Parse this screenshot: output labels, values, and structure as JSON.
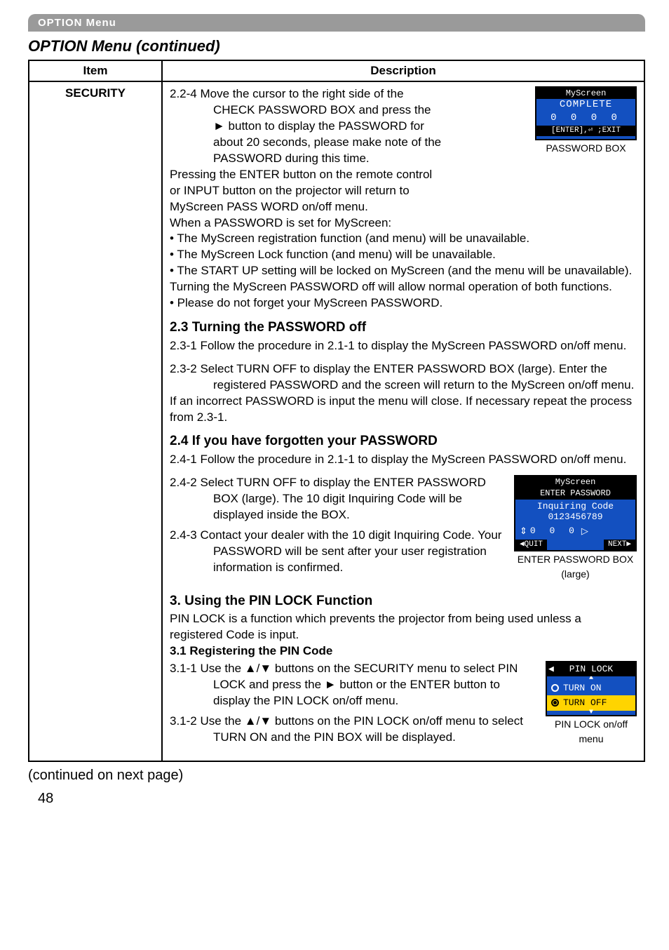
{
  "header": {
    "menu_label": "OPTION Menu",
    "title": "OPTION Menu (continued)"
  },
  "table": {
    "col_item": "Item",
    "col_desc": "Description",
    "item_name": "SECURITY"
  },
  "sec224": {
    "lead": "2.2-4 Move the cursor to the right side of the",
    "l1": "CHECK PASSWORD BOX and press the",
    "l2": "► button to display the PASSWORD for",
    "l3": "about 20 seconds, please make note of the",
    "l4": "PASSWORD during this time.",
    "p1": "Pressing the ENTER button on the remote control",
    "p2": "or INPUT button on the projector will return to",
    "p3": "MyScreen PASS WORD on/off menu.",
    "w": "When a PASSWORD is set for MyScreen:",
    "b1": "• The MyScreen registration function (and menu) will be unavailable.",
    "b2": "• The MyScreen Lock function (and menu) will be unavailable.",
    "b3": "• The START UP setting will be locked on MyScreen (and the menu will be unavailable).",
    "t1": "Turning the MyScreen PASSWORD off will allow normal operation of both functions.",
    "t2": "• Please do not forget your MyScreen PASSWORD."
  },
  "sec23": {
    "h": "2.3 Turning the PASSWORD off",
    "s1": "2.3-1 Follow the procedure in 2.1-1 to display the MyScreen PASSWORD on/off menu.",
    "s2a": "2.3-2 Select TURN OFF to display the ENTER PASSWORD BOX (large). Enter the registered PASSWORD and the screen will return to the MyScreen on/off menu.",
    "s2b": "If an incorrect PASSWORD is input the menu will close. If necessary repeat the process from 2.3-1."
  },
  "sec24": {
    "h": "2.4 If you have forgotten your PASSWORD",
    "s1": "2.4-1 Follow the procedure in 2.1-1 to display the MyScreen PASSWORD on/off menu.",
    "s2": "2.4-2 Select TURN OFF to display the ENTER PASSWORD BOX (large). The 10 digit Inquiring Code will be displayed inside the BOX.",
    "s3": "2.4-3 Contact your dealer with the 10 digit Inquiring Code. Your PASSWORD will be sent after your user registration information is confirmed."
  },
  "sec3": {
    "h": "3. Using the PIN LOCK Function",
    "p": "PIN LOCK is a function which prevents the projector from being used unless a registered Code is input.",
    "h31": "3.1 Registering the PIN Code",
    "s1": "3.1-1 Use the ▲/▼ buttons on the SECURITY menu to select PIN LOCK and press the ► button or the ENTER button to display the PIN LOCK on/off menu.",
    "s2": "3.1-2 Use the ▲/▼ buttons on the PIN LOCK on/off menu to select TURN ON and the PIN BOX will be displayed."
  },
  "pwbox": {
    "hdr": "MyScreen",
    "hdr2": "COMPLETE",
    "digits": "0 0 0 0",
    "exit": "[ENTER],⏎ ;EXIT",
    "caption": "PASSWORD BOX"
  },
  "epbox": {
    "hdr": "MyScreen",
    "hdr2": "ENTER PASSWORD",
    "l1": "Inquiring Code",
    "l2": "0123456789",
    "slot": "0 0 0",
    "quit": "◀QUIT",
    "next": "NEXT▶",
    "caption1": "ENTER PASSWORD BOX",
    "caption2": "(large)"
  },
  "plbox": {
    "hdr": "PIN LOCK",
    "on": "TURN ON",
    "off": "TURN OFF",
    "caption1": "PIN LOCK on/off",
    "caption2": "menu"
  },
  "footer": {
    "note": "(continued on next page)",
    "page": "48"
  }
}
